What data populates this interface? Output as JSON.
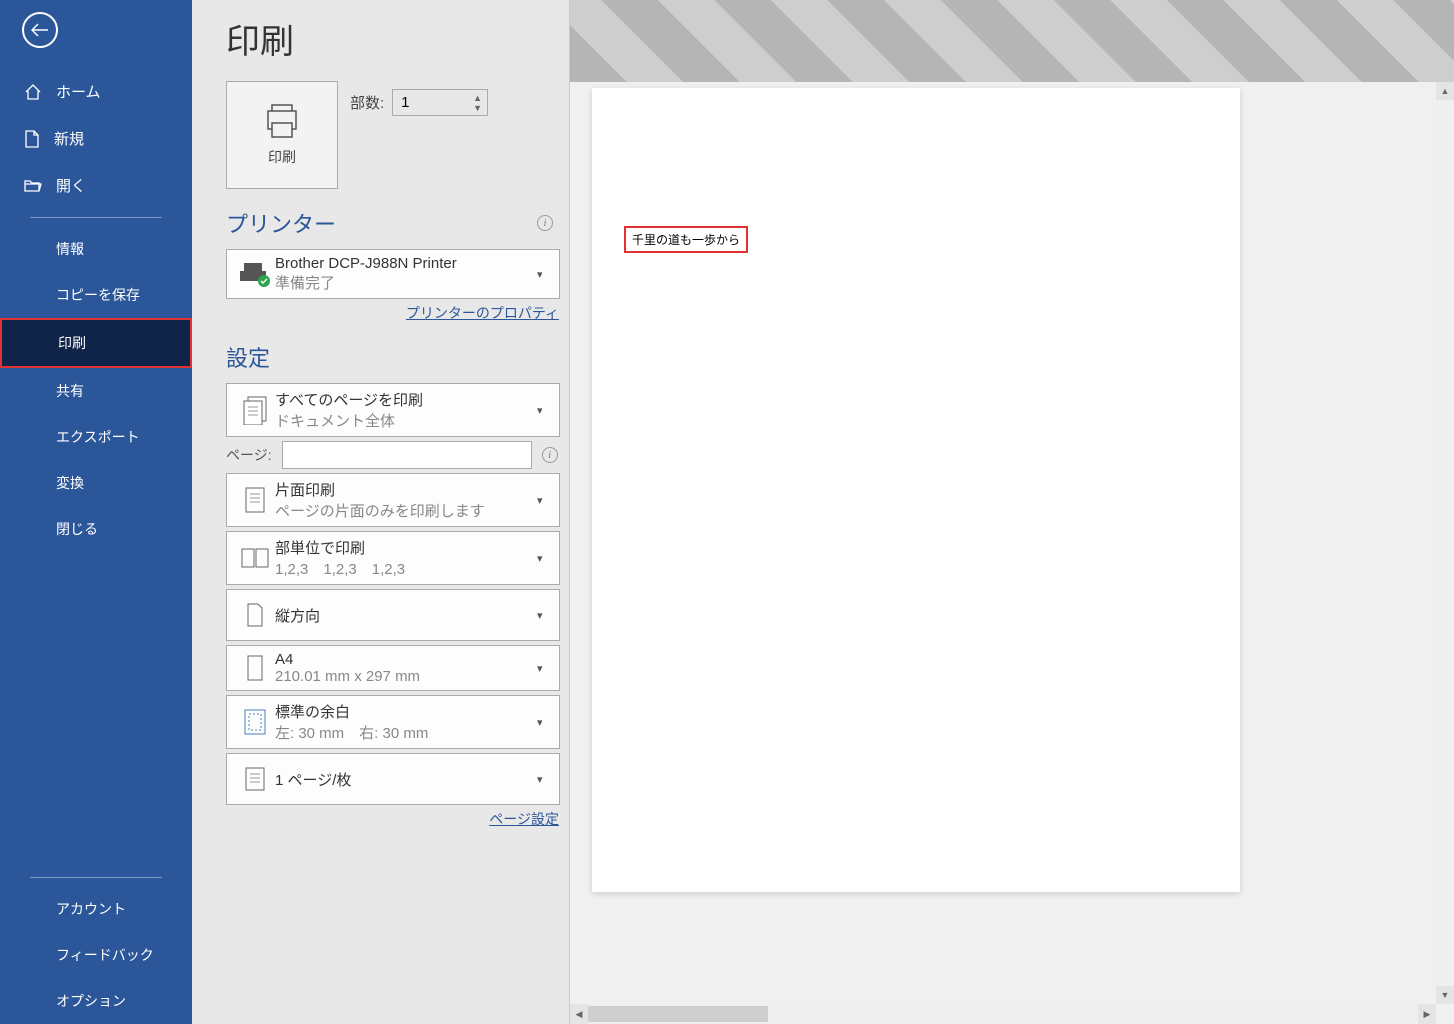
{
  "page": {
    "title": "印刷"
  },
  "sidebar": {
    "home": "ホーム",
    "new": "新規",
    "open": "開く",
    "info": "情報",
    "saveCopy": "コピーを保存",
    "print": "印刷",
    "share": "共有",
    "export": "エクスポート",
    "transform": "変換",
    "close": "閉じる",
    "account": "アカウント",
    "feedback": "フィードバック",
    "options": "オプション"
  },
  "printAction": {
    "label": "印刷"
  },
  "copies": {
    "label": "部数:",
    "value": "1"
  },
  "sections": {
    "printer": "プリンター",
    "settings": "設定"
  },
  "printer": {
    "name": "Brother DCP-J988N Printer",
    "status": "準備完了",
    "propsLink": "プリンターのプロパティ"
  },
  "settings": {
    "allPages": {
      "title": "すべてのページを印刷",
      "subtitle": "ドキュメント全体"
    },
    "pagesLabel": "ページ:",
    "pagesValue": "",
    "side": {
      "title": "片面印刷",
      "subtitle": "ページの片面のみを印刷します"
    },
    "collate": {
      "title": "部単位で印刷",
      "subtitle": "1,2,3　1,2,3　1,2,3"
    },
    "orientation": {
      "title": "縦方向"
    },
    "paper": {
      "title": "A4",
      "subtitle": "210.01 mm x 297 mm"
    },
    "margin": {
      "title": "標準の余白",
      "subtitle": "左:  30 mm　右:  30 mm"
    },
    "perSheet": {
      "title": "1 ページ/枚"
    },
    "pageSetupLink": "ページ設定"
  },
  "preview": {
    "text": "千里の道も一歩から"
  }
}
